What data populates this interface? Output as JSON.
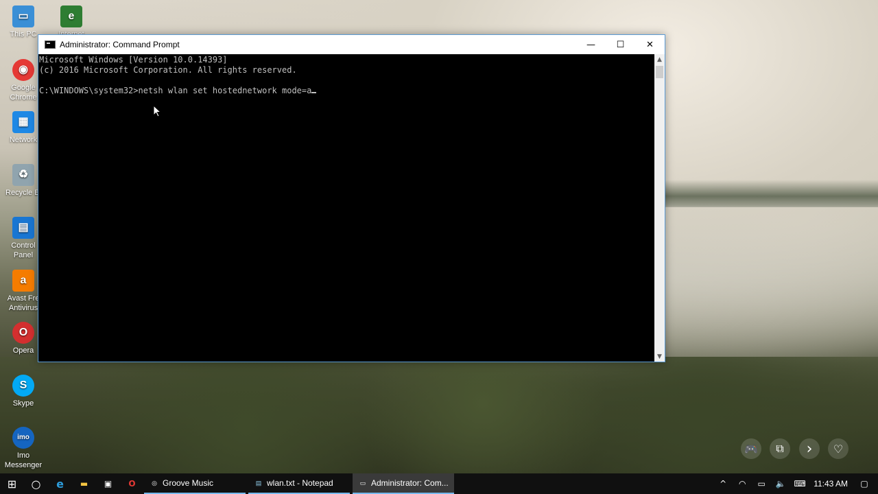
{
  "desktop": {
    "icons": [
      {
        "label": "This PC",
        "color": "#3a8fd6",
        "glyph": "▭"
      },
      {
        "label": "Internet",
        "color": "#2e7d32",
        "glyph": "e"
      },
      {
        "label": "Google Chrome",
        "color": "#e53935",
        "glyph": "◉"
      },
      {
        "label": "Network",
        "color": "#1e88e5",
        "glyph": "▦"
      },
      {
        "label": "Recycle Bi",
        "color": "#90a4ae",
        "glyph": "♻"
      },
      {
        "label": "Control Panel",
        "color": "#1976d2",
        "glyph": "▤"
      },
      {
        "label": "Avast Fre Antivirus",
        "color": "#f57c00",
        "glyph": "a"
      },
      {
        "label": "Opera",
        "color": "#d32f2f",
        "glyph": "O"
      },
      {
        "label": "Skype",
        "color": "#03a9f4",
        "glyph": "S"
      },
      {
        "label": "Imo Messenger",
        "color": "#1565c0",
        "glyph": "imo"
      }
    ]
  },
  "window": {
    "title": "Administrator: Command Prompt",
    "minimize_glyph": "—",
    "maximize_glyph": "☐",
    "close_glyph": "✕",
    "console": {
      "lines": [
        "Microsoft Windows [Version 10.0.14393]",
        "(c) 2016 Microsoft Corporation. All rights reserved.",
        "",
        "C:\\WINDOWS\\system32>netsh wlan set hostednetwork mode=a"
      ]
    },
    "scroll_up": "▲",
    "scroll_down": "▼"
  },
  "overlay": {
    "gamepad": "🎮",
    "copy": "⧉",
    "next": "›",
    "heart": "♡"
  },
  "taskbar": {
    "start_glyph": "⊞",
    "cortana_glyph": "○",
    "edge_glyph": "e",
    "explorer_glyph": "▬",
    "store_glyph": "▣",
    "opera_glyph": "O",
    "apps": [
      {
        "label": "Groove Music",
        "icon": "◎",
        "active": false
      },
      {
        "label": "wlan.txt - Notepad",
        "icon": "▤",
        "active": false
      },
      {
        "label": "Administrator: Com...",
        "icon": "▭",
        "active": true
      }
    ],
    "tray": {
      "chevron": "^",
      "wifi": "◠",
      "battery": "▭",
      "volume": "🔈",
      "keyboard": "⌨",
      "time": "11:43 AM",
      "notifications": "▢"
    }
  }
}
